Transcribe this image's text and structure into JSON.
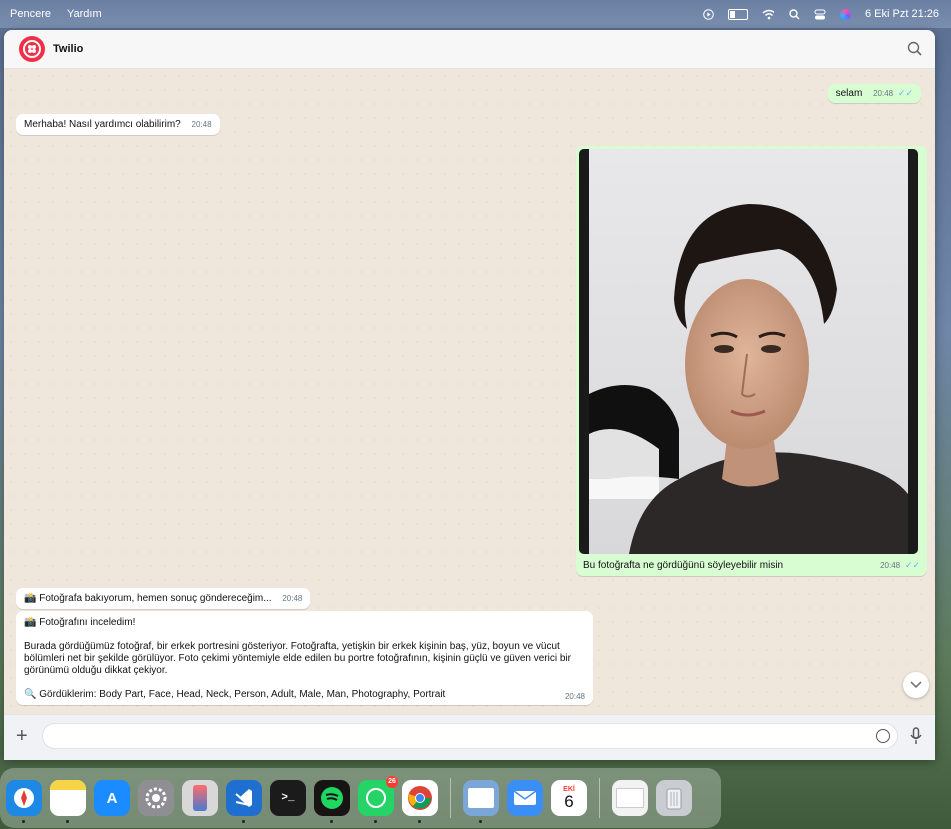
{
  "menubar": {
    "left_items": [
      "Pencere",
      "Yardım"
    ],
    "datetime": "6 Eki Pzt  21:26"
  },
  "chat": {
    "contact_name": "Twilio",
    "messages": [
      {
        "id": "m1",
        "direction": "out",
        "text": "selam",
        "time": "20:48",
        "ticks": "✓✓"
      },
      {
        "id": "m2",
        "direction": "in",
        "text": "Merhaba! Nasıl yardımcı olabilirim?",
        "time": "20:48"
      },
      {
        "id": "m3",
        "direction": "out",
        "type": "image",
        "caption": "Bu fotoğrafta ne gördüğünü söyleyebilir misin",
        "time": "20:48",
        "ticks": "✓✓"
      },
      {
        "id": "m4",
        "direction": "in",
        "text": "📸 Fotoğrafa bakıyorum, hemen sonuç göndereceğim...",
        "time": "20:48"
      },
      {
        "id": "m5",
        "direction": "in",
        "line1": "📸 Fotoğrafını inceledim!",
        "line2": "Burada gördüğümüz fotoğraf, bir erkek portresini gösteriyor. Fotoğrafta, yetişkin bir erkek kişinin baş, yüz, boyun ve vücut bölümleri net bir şekilde görülüyor. Foto çekimi yöntemiyle elde edilen bu portre fotoğrafının, kişinin güçlü ve güven verici bir görünümü olduğu dikkat çekiyor.",
        "line3": "🔍 Gördüklerim: Body Part, Face, Head, Neck, Person, Adult, Male, Man, Photography, Portrait",
        "time": "20:48"
      }
    ]
  },
  "composer": {
    "placeholder": ""
  },
  "dock": {
    "apps": [
      {
        "name": "Safari",
        "color": "#1e88e5"
      },
      {
        "name": "Notes",
        "color": "#f5d547"
      },
      {
        "name": "App Store",
        "color": "#1a8cff"
      },
      {
        "name": "System Settings",
        "color": "#8e8e93"
      },
      {
        "name": "iPhone Mirroring",
        "color": "#d8d8d8"
      },
      {
        "name": "Visual Studio Code",
        "color": "#1f6fd1"
      },
      {
        "name": "Terminal",
        "color": "#1b1b1b"
      },
      {
        "name": "Spotify",
        "color": "#191414"
      },
      {
        "name": "WhatsApp",
        "color": "#25d366",
        "badge": "26"
      },
      {
        "name": "Chrome",
        "color": "#ffffff"
      },
      {
        "name": "Preview",
        "color": "#7aa6d8"
      },
      {
        "name": "Mail",
        "color": "#3a8ef6"
      },
      {
        "name": "Calendar",
        "color": "#ffffff",
        "month": "EKİ",
        "day": "6"
      },
      {
        "name": "Document",
        "color": "#f2f2f2"
      },
      {
        "name": "Trash",
        "color": "#c9cdd1"
      }
    ]
  },
  "colors": {
    "accent": "#f22f46",
    "outgoing": "#d9fdd3",
    "incoming": "#ffffff",
    "chat_bg": "#efe7dc"
  }
}
